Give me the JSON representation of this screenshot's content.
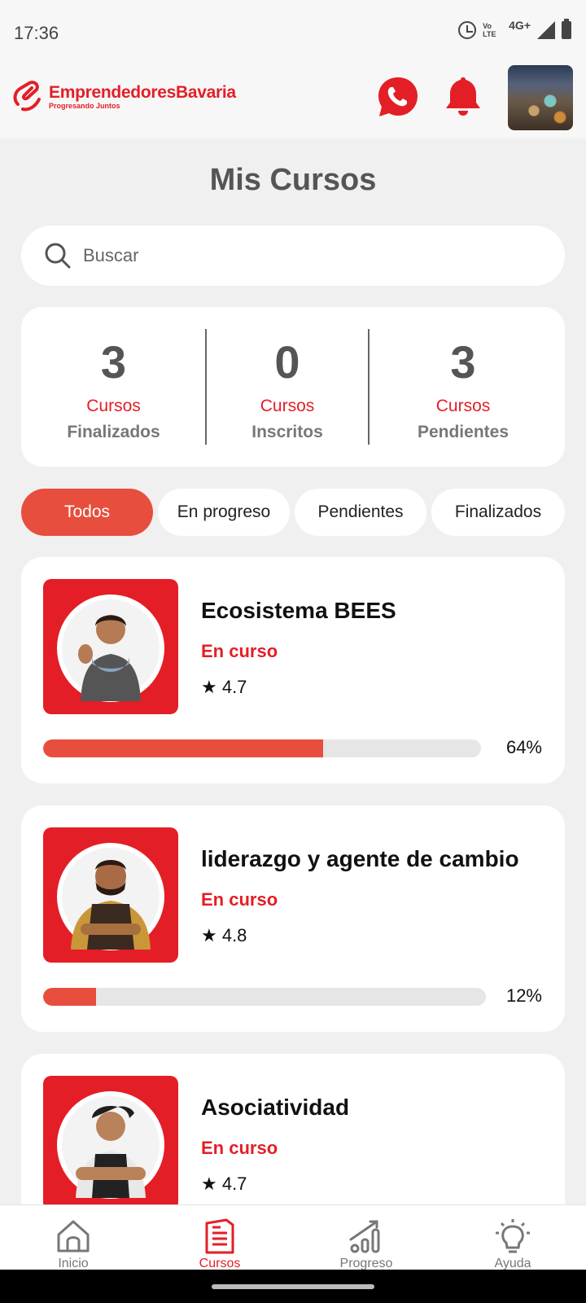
{
  "status_bar": {
    "time": "17:36",
    "volte": "Vo LTE",
    "network": "4G+"
  },
  "header": {
    "brand_name": "EmprendedoresBavaria",
    "brand_tagline": "Progresando Juntos",
    "whatsapp_icon": "whatsapp-icon",
    "bell_icon": "bell-icon"
  },
  "page_title": "Mis Cursos",
  "search": {
    "placeholder": "Buscar",
    "value": ""
  },
  "stats": [
    {
      "value": "3",
      "line1": "Cursos",
      "line2": "Finalizados"
    },
    {
      "value": "0",
      "line1": "Cursos",
      "line2": "Inscritos"
    },
    {
      "value": "3",
      "line1": "Cursos",
      "line2": "Pendientes"
    }
  ],
  "filters": [
    "Todos",
    "En progreso",
    "Pendientes",
    "Finalizados"
  ],
  "selected_filter": "Todos",
  "courses": [
    {
      "title": "Ecosistema BEES",
      "status": "En curso",
      "rating": "★ 4.7",
      "progress_label": "64%",
      "progress": 0.64
    },
    {
      "title": "liderazgo y agente de cambio",
      "status": "En curso",
      "rating": "★ 4.8",
      "progress_label": "12%",
      "progress": 0.12
    },
    {
      "title": "Asociatividad",
      "status": "En curso",
      "rating": "★ 4.7"
    }
  ],
  "nav": [
    {
      "label": "Inicio",
      "icon": "home-icon"
    },
    {
      "label": "Cursos",
      "icon": "document-icon"
    },
    {
      "label": "Progreso",
      "icon": "progress-chart-icon"
    },
    {
      "label": "Ayuda",
      "icon": "lightbulb-icon"
    }
  ],
  "colors": {
    "brand_red": "#e41e26",
    "accent": "#e84e3d",
    "background": "#f0f0f0"
  }
}
